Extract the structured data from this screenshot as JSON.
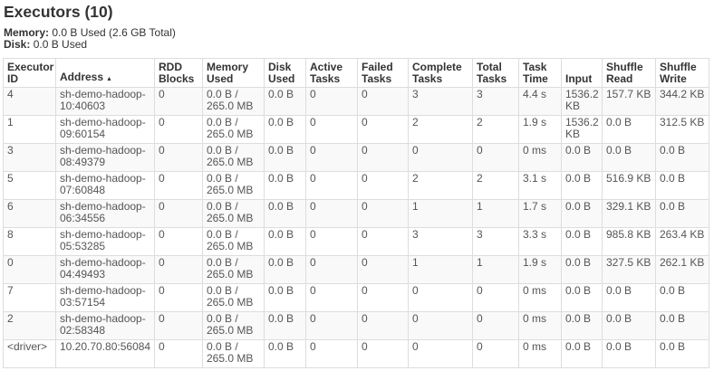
{
  "title": "Executors (10)",
  "memory": {
    "label": "Memory:",
    "value": "0.0 B Used (2.6 GB Total)"
  },
  "disk": {
    "label": "Disk:",
    "value": "0.0 B Used"
  },
  "columns": [
    "Executor ID",
    "Address",
    "RDD Blocks",
    "Memory Used",
    "Disk Used",
    "Active Tasks",
    "Failed Tasks",
    "Complete Tasks",
    "Total Tasks",
    "Task Time",
    "Input",
    "Shuffle Read",
    "Shuffle Write"
  ],
  "sorted_column": "Address",
  "sort_icon": "▲",
  "rows": [
    [
      "4",
      "sh-demo-hadoop-10:40603",
      "0",
      "0.0 B / 265.0 MB",
      "0.0 B",
      "0",
      "0",
      "3",
      "3",
      "4.4 s",
      "1536.2 KB",
      "157.7 KB",
      "344.2 KB"
    ],
    [
      "1",
      "sh-demo-hadoop-09:60154",
      "0",
      "0.0 B / 265.0 MB",
      "0.0 B",
      "0",
      "0",
      "2",
      "2",
      "1.9 s",
      "1536.2 KB",
      "0.0 B",
      "312.5 KB"
    ],
    [
      "3",
      "sh-demo-hadoop-08:49379",
      "0",
      "0.0 B / 265.0 MB",
      "0.0 B",
      "0",
      "0",
      "0",
      "0",
      "0 ms",
      "0.0 B",
      "0.0 B",
      "0.0 B"
    ],
    [
      "5",
      "sh-demo-hadoop-07:60848",
      "0",
      "0.0 B / 265.0 MB",
      "0.0 B",
      "0",
      "0",
      "2",
      "2",
      "3.1 s",
      "0.0 B",
      "516.9 KB",
      "0.0 B"
    ],
    [
      "6",
      "sh-demo-hadoop-06:34556",
      "0",
      "0.0 B / 265.0 MB",
      "0.0 B",
      "0",
      "0",
      "1",
      "1",
      "1.7 s",
      "0.0 B",
      "329.1 KB",
      "0.0 B"
    ],
    [
      "8",
      "sh-demo-hadoop-05:53285",
      "0",
      "0.0 B / 265.0 MB",
      "0.0 B",
      "0",
      "0",
      "3",
      "3",
      "3.3 s",
      "0.0 B",
      "985.8 KB",
      "263.4 KB"
    ],
    [
      "0",
      "sh-demo-hadoop-04:49493",
      "0",
      "0.0 B / 265.0 MB",
      "0.0 B",
      "0",
      "0",
      "1",
      "1",
      "1.9 s",
      "0.0 B",
      "327.5 KB",
      "262.1 KB"
    ],
    [
      "7",
      "sh-demo-hadoop-03:57154",
      "0",
      "0.0 B / 265.0 MB",
      "0.0 B",
      "0",
      "0",
      "0",
      "0",
      "0 ms",
      "0.0 B",
      "0.0 B",
      "0.0 B"
    ],
    [
      "2",
      "sh-demo-hadoop-02:58348",
      "0",
      "0.0 B / 265.0 MB",
      "0.0 B",
      "0",
      "0",
      "0",
      "0",
      "0 ms",
      "0.0 B",
      "0.0 B",
      "0.0 B"
    ],
    [
      "<driver>",
      "10.20.70.80:56084",
      "0",
      "0.0 B / 265.0 MB",
      "0.0 B",
      "0",
      "0",
      "0",
      "0",
      "0 ms",
      "0.0 B",
      "0.0 B",
      "0.0 B"
    ]
  ]
}
